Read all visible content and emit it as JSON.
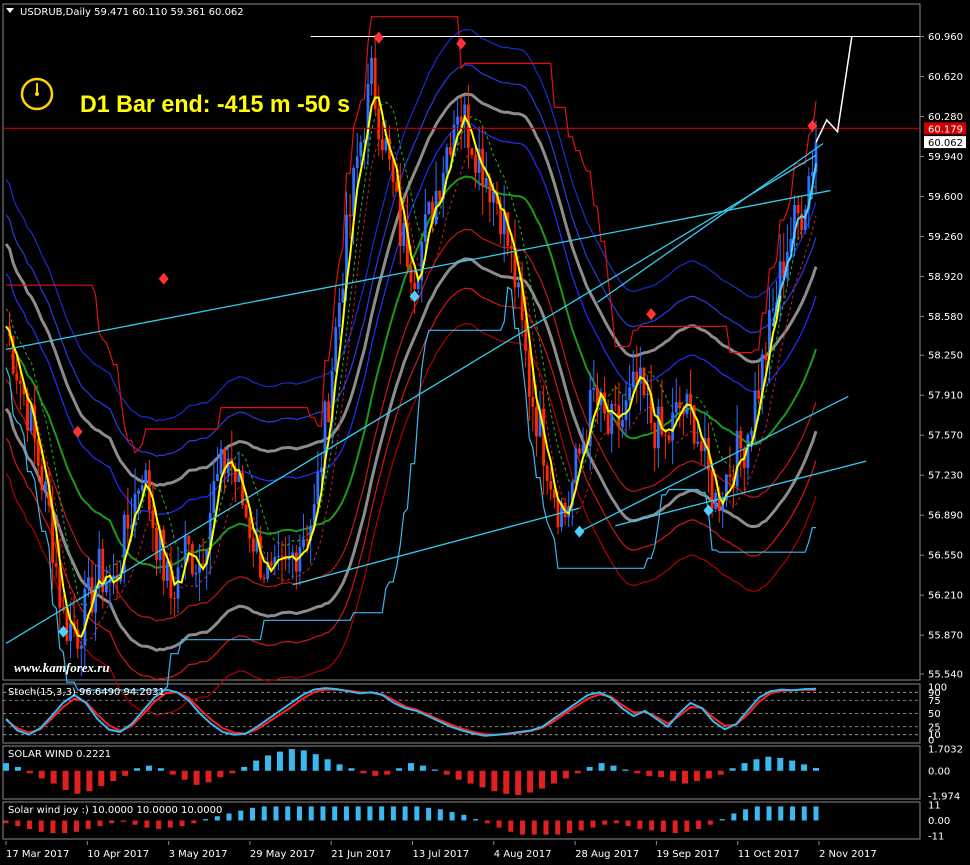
{
  "header": {
    "symbol_line": "USDRUB,Daily  59.471 60.110 59.361 60.062",
    "timer_text": "D1 Bar end: -415 m -50 s",
    "watermark": "www.kamforex.ru"
  },
  "chart_data": [
    {
      "type": "candlestick",
      "title": "USDRUB,Daily",
      "ohlc_last": {
        "open": 59.471,
        "high": 60.11,
        "low": 59.361,
        "close": 60.062
      },
      "ylim": [
        55.54,
        61.1
      ],
      "y_ticks": [
        "60.960",
        "60.620",
        "60.280",
        "59.940",
        "59.600",
        "59.260",
        "58.920",
        "58.580",
        "58.250",
        "57.910",
        "57.570",
        "57.230",
        "56.890",
        "56.550",
        "56.210",
        "55.870",
        "55.540"
      ],
      "price_tags": [
        {
          "label": "60.179",
          "value": 60.179,
          "color": "#cc0000"
        },
        {
          "label": "60.062",
          "value": 60.062,
          "color": "#ffffff"
        }
      ],
      "x_ticks": [
        "17 Mar 2017",
        "10 Apr 2017",
        "3 May 2017",
        "29 May 2017",
        "21 Jun 2017",
        "13 Jul 2017",
        "4 Aug 2017",
        "28 Aug 2017",
        "19 Sep 2017",
        "11 Oct 2017",
        "2 Nov 2017"
      ],
      "close_path": [
        [
          0,
          58.5
        ],
        [
          6,
          57.8
        ],
        [
          12,
          56.9
        ],
        [
          16,
          56.0
        ],
        [
          20,
          55.9
        ],
        [
          26,
          56.4
        ],
        [
          30,
          56.3
        ],
        [
          34,
          56.8
        ],
        [
          38,
          57.3
        ],
        [
          42,
          56.7
        ],
        [
          46,
          56.2
        ],
        [
          50,
          56.6
        ],
        [
          54,
          56.5
        ],
        [
          58,
          57.1
        ],
        [
          62,
          57.4
        ],
        [
          66,
          57.0
        ],
        [
          70,
          56.6
        ],
        [
          74,
          56.3
        ],
        [
          78,
          56.4
        ],
        [
          82,
          56.7
        ],
        [
          86,
          56.9
        ],
        [
          90,
          57.9
        ],
        [
          94,
          59.0
        ],
        [
          98,
          59.9
        ],
        [
          102,
          60.6
        ],
        [
          106,
          60.0
        ],
        [
          110,
          59.3
        ],
        [
          114,
          59.0
        ],
        [
          118,
          59.4
        ],
        [
          122,
          59.9
        ],
        [
          126,
          60.4
        ],
        [
          130,
          60.1
        ],
        [
          134,
          59.8
        ],
        [
          138,
          59.5
        ],
        [
          142,
          58.9
        ],
        [
          146,
          58.0
        ],
        [
          150,
          57.5
        ],
        [
          154,
          57.0
        ],
        [
          156,
          56.9
        ],
        [
          160,
          57.4
        ],
        [
          164,
          57.9
        ],
        [
          168,
          57.6
        ],
        [
          172,
          57.7
        ],
        [
          176,
          58.0
        ],
        [
          180,
          57.7
        ],
        [
          184,
          57.5
        ],
        [
          188,
          57.8
        ],
        [
          192,
          57.7
        ],
        [
          196,
          57.2
        ],
        [
          198,
          57.0
        ],
        [
          202,
          57.3
        ],
        [
          206,
          57.5
        ],
        [
          210,
          58.0
        ],
        [
          214,
          58.6
        ],
        [
          218,
          59.2
        ],
        [
          222,
          59.5
        ],
        [
          226,
          60.06
        ]
      ],
      "levels": {
        "resistance": 60.179,
        "top_line": 60.96
      }
    },
    {
      "type": "line",
      "title": "Stoch(15,3,3) 96.6490 94.2031",
      "ylim": [
        0,
        100
      ],
      "y_ticks": [
        "100",
        "90",
        "75",
        "50",
        "25",
        "10",
        "0"
      ],
      "values": [
        40,
        18,
        10,
        22,
        45,
        70,
        85,
        70,
        40,
        20,
        15,
        30,
        55,
        80,
        95,
        90,
        75,
        50,
        30,
        15,
        10,
        12,
        25,
        40,
        55,
        70,
        85,
        95,
        98,
        96,
        92,
        88,
        90,
        85,
        70,
        60,
        55,
        45,
        35,
        25,
        18,
        12,
        8,
        10,
        12,
        15,
        18,
        25,
        40,
        55,
        70,
        85,
        90,
        80,
        60,
        45,
        55,
        40,
        25,
        50,
        70,
        60,
        35,
        20,
        30,
        55,
        80,
        92,
        95,
        94,
        96,
        96.6
      ],
      "signal": [
        38,
        22,
        14,
        20,
        40,
        62,
        78,
        72,
        48,
        28,
        18,
        26,
        48,
        72,
        88,
        90,
        80,
        58,
        38,
        22,
        14,
        12,
        20,
        34,
        48,
        62,
        78,
        90,
        95,
        95,
        93,
        90,
        89,
        86,
        75,
        63,
        57,
        48,
        38,
        29,
        21,
        15,
        11,
        10,
        11,
        14,
        17,
        23,
        35,
        50,
        64,
        78,
        86,
        82,
        66,
        52,
        53,
        44,
        31,
        45,
        62,
        61,
        42,
        27,
        29,
        48,
        72,
        88,
        93,
        94,
        95,
        94.2
      ]
    },
    {
      "type": "bar",
      "title": "SOLAR WIND 0.2221",
      "y_ticks": [
        "1.7032",
        "0.00",
        "-1.974"
      ],
      "ylim": [
        -1.974,
        1.7032
      ],
      "values": [
        0.6,
        0.3,
        -0.2,
        -0.6,
        -1.0,
        -1.5,
        -1.8,
        -1.6,
        -1.2,
        -0.8,
        -0.4,
        0.2,
        0.4,
        0.2,
        -0.3,
        -0.7,
        -1.1,
        -0.9,
        -0.5,
        -0.2,
        0.3,
        0.8,
        1.2,
        1.5,
        1.7,
        1.6,
        1.3,
        0.9,
        0.5,
        0.2,
        -0.2,
        -0.4,
        -0.3,
        0.2,
        0.6,
        0.4,
        0.1,
        -0.3,
        -0.7,
        -1.0,
        -1.3,
        -1.6,
        -1.8,
        -1.9,
        -1.7,
        -1.4,
        -1.0,
        -0.6,
        -0.2,
        0.3,
        0.6,
        0.4,
        0.1,
        -0.2,
        -0.4,
        -0.5,
        -0.8,
        -1.0,
        -0.8,
        -0.6,
        -0.3,
        0.2,
        0.6,
        0.9,
        1.1,
        1.0,
        0.8,
        0.5,
        0.2221
      ]
    },
    {
      "type": "bar",
      "title": "Solar wind joy :) 10.0000 10.0000 10.0000",
      "y_ticks": [
        "11",
        "0.00",
        "-11"
      ],
      "ylim": [
        -11,
        11
      ],
      "values": [
        -2,
        -4,
        -6,
        -8,
        -9,
        -9,
        -8,
        -6,
        -4,
        -2,
        -1,
        -3,
        -5,
        -6,
        -5,
        -4,
        -2,
        1,
        3,
        5,
        7,
        9,
        10,
        10,
        10,
        10,
        10,
        10,
        10,
        10,
        10,
        10,
        10,
        10,
        10,
        10,
        9,
        8,
        6,
        4,
        1,
        -2,
        -5,
        -8,
        -10,
        -10,
        -10,
        -10,
        -9,
        -7,
        -5,
        -3,
        -2,
        -4,
        -6,
        -7,
        -8,
        -9,
        -8,
        -6,
        -3,
        1,
        5,
        8,
        10,
        10,
        10,
        10,
        10,
        10
      ]
    }
  ],
  "colors": {
    "bg": "#000000",
    "bull": "#2f6fff",
    "bear": "#ff2a00",
    "fast_ma": "#ffff00",
    "cyan": "#4fd0ff",
    "solar_pos": "#3ab8f0",
    "solar_neg": "#e02020"
  }
}
